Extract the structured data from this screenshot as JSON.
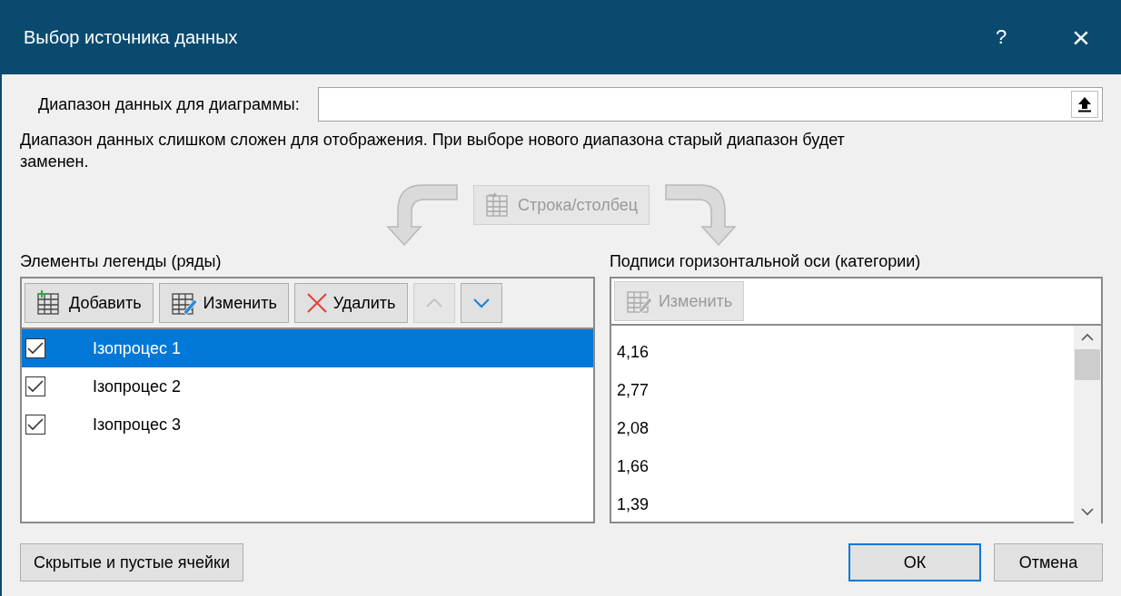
{
  "window": {
    "title": "Выбор источника данных",
    "help": "?",
    "close": "×"
  },
  "range": {
    "label": "Диапазон данных для диаграммы:"
  },
  "message": "Диапазон данных слишком сложен для отображения. При выборе нового диапазона старый диапазон будет заменен.",
  "switch_button": {
    "label": "Строка/столбец",
    "disabled": true
  },
  "legend": {
    "heading": "Элементы легенды (ряды)",
    "toolbar": [
      {
        "kind": "add",
        "label": "Добавить",
        "disabled": false
      },
      {
        "kind": "edit",
        "label": "Изменить",
        "disabled": false
      },
      {
        "kind": "delete",
        "label": "Удалить",
        "disabled": false
      },
      {
        "kind": "up",
        "disabled": true
      },
      {
        "kind": "down",
        "disabled": false
      }
    ],
    "series": [
      {
        "name": "Ізопроцес 1",
        "checked": true,
        "selected": true
      },
      {
        "name": "Ізопроцес 2",
        "checked": true,
        "selected": false
      },
      {
        "name": "Ізопроцес 3",
        "checked": true,
        "selected": false
      }
    ]
  },
  "axis": {
    "heading": "Подписи горизонтальной оси (категории)",
    "edit_button": {
      "label": "Изменить",
      "disabled": true
    },
    "items": [
      "4,16",
      "2,77",
      "2,08",
      "1,66",
      "1,39"
    ]
  },
  "footer": {
    "hidden_cells": "Скрытые и пустые ячейки",
    "ok": "ОК",
    "cancel": "Отмена"
  }
}
